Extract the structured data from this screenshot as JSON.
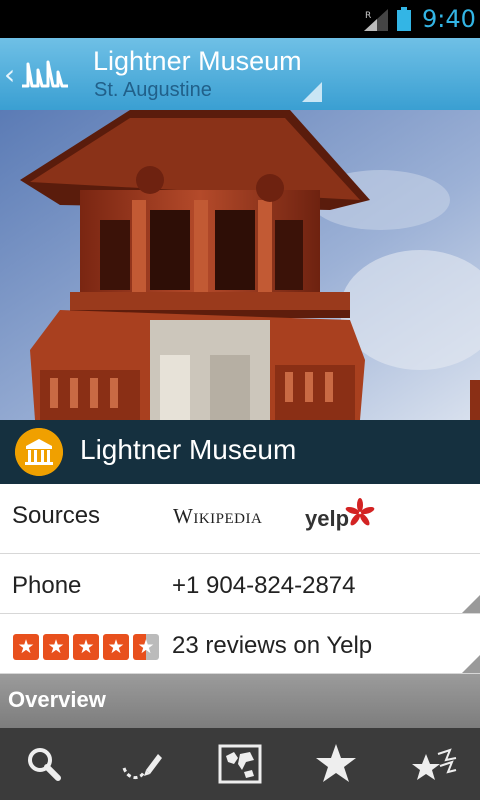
{
  "status_bar": {
    "time": "9:40",
    "roaming_indicator": "R",
    "icons": [
      "signal-icon",
      "battery-icon"
    ]
  },
  "action_bar": {
    "title": "Lightner Museum",
    "subtitle": "St. Augustine",
    "icons": [
      "up-caret-icon",
      "app-logo-icon",
      "dropdown-indicator-icon"
    ]
  },
  "hero_image": {
    "subject": "Lightner Museum tower photo"
  },
  "place": {
    "name": "Lightner Museum",
    "icon": "museum-icon"
  },
  "sources": {
    "label": "Sources",
    "wikipedia": "Wikipedia",
    "yelp": "yelp"
  },
  "phone": {
    "label": "Phone",
    "value": "+1 904-824-2874"
  },
  "reviews": {
    "rating": 4.5,
    "max_rating": 5,
    "text": "23 reviews on Yelp"
  },
  "overview": {
    "label": "Overview"
  },
  "bottom_bar": {
    "items": [
      "search-icon",
      "draw-route-icon",
      "map-icon",
      "favorites-star-icon",
      "popular-stars-icon"
    ]
  },
  "colors": {
    "accent": "#33b5e5",
    "action_bar_top": "#6fc0e6",
    "action_bar_bottom": "#3a9fd2",
    "name_bar": "#15303f",
    "yelp_star": "#e8501d",
    "overview_bar": "#8a8a8a",
    "bottom_bar": "#3b3b3b"
  }
}
